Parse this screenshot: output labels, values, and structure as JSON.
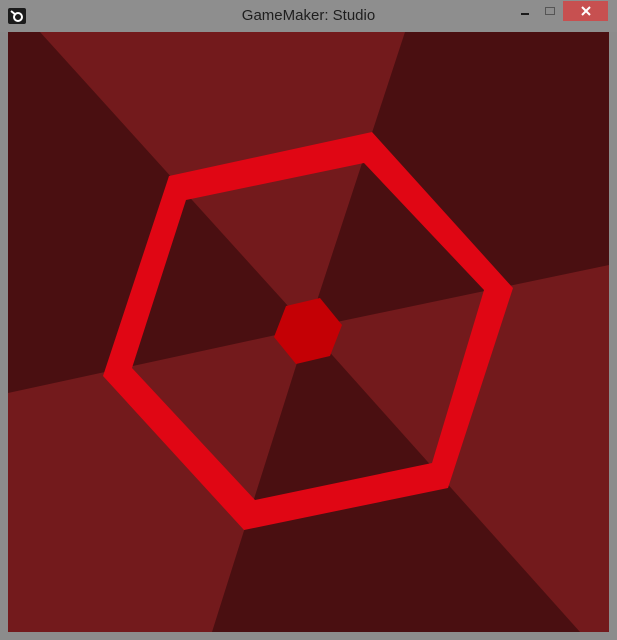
{
  "window": {
    "title": "GameMaker: Studio",
    "controls": {
      "minimize_icon": "minimize-icon",
      "maximize_icon": "maximize-icon",
      "close_icon": "close-icon"
    }
  },
  "game": {
    "colors": {
      "dark_sector": "#4a0f11",
      "light_sector": "#731a1c",
      "hexagon_wall": "#e00614",
      "center_hexagon": "#c40005",
      "close_button": "#c75050"
    }
  }
}
